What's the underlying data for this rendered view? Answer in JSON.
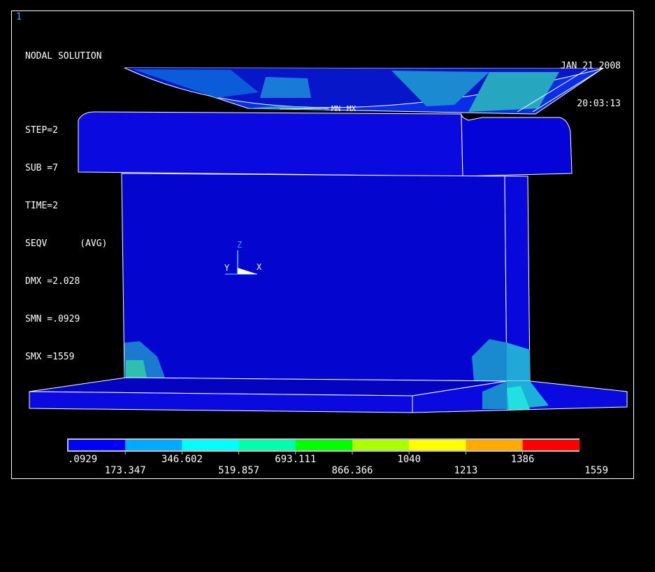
{
  "window_number": "1",
  "plot_title": "NODAL SOLUTION",
  "info_lines": [
    "STEP=2",
    "SUB =7",
    "TIME=2",
    "SEQV      (AVG)",
    "DMX =2.028",
    "SMN =.0929",
    "SMX =1559"
  ],
  "date": "JAN 21 2008",
  "time": "20:03:13",
  "markers": {
    "min": "MN",
    "max": "MX"
  },
  "triad": {
    "z": "Z",
    "y": "Y",
    "x": "X"
  },
  "legend": {
    "colors": [
      "#0000ff",
      "#00aaff",
      "#00ffff",
      "#00ffaa",
      "#00ff00",
      "#aaff00",
      "#ffff00",
      "#ffaa00",
      "#ff0000"
    ],
    "labels_upper": [
      ".0929",
      "346.602",
      "693.111",
      "1040",
      "1386"
    ],
    "labels_lower": [
      "173.347",
      "519.857",
      "866.366",
      "1213",
      "1559"
    ]
  }
}
